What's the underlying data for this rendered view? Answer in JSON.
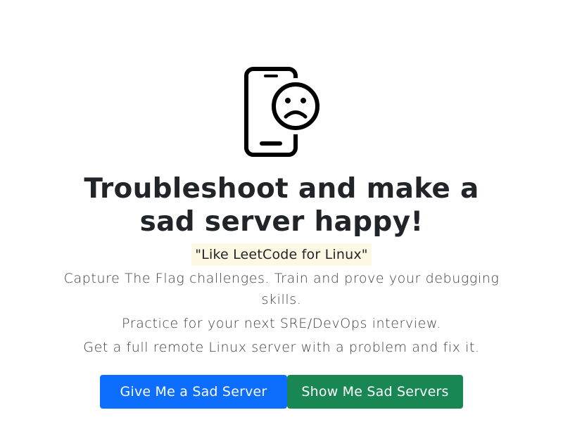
{
  "hero": {
    "icon": "sad-phone-icon",
    "title_line1": "Troubleshoot and make a",
    "title_line2": "sad server happy!",
    "tagline": "\"Like LeetCode for Linux\"",
    "lead_line1a": "Capture The Flag challenges. Train and prove your debugging",
    "lead_line1b": "skills.",
    "lead_line2": "Practice for your next SRE/DevOps interview.",
    "lead_line3": "Get a full remote Linux server with a problem and fix it."
  },
  "buttons": {
    "primary_label": "Give Me a Sad Server",
    "secondary_label": "Show Me Sad Servers"
  },
  "colors": {
    "primary": "#0d6efd",
    "success": "#198754",
    "highlight": "#fcf8e3",
    "text": "#212529"
  }
}
